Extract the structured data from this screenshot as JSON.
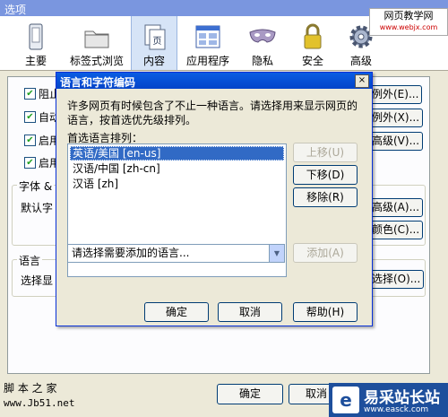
{
  "window": {
    "title": "选项"
  },
  "toolbar": {
    "items": [
      {
        "label": "主要",
        "icon": "general-icon"
      },
      {
        "label": "标签式浏览",
        "icon": "folder-icon"
      },
      {
        "label": "内容",
        "icon": "content-icon",
        "selected": true
      },
      {
        "label": "应用程序",
        "icon": "applications-icon"
      },
      {
        "label": "隐私",
        "icon": "privacy-mask-icon"
      },
      {
        "label": "安全",
        "icon": "lock-icon"
      },
      {
        "label": "高级",
        "icon": "gear-icon"
      }
    ]
  },
  "watermark_top": {
    "line1": "网页教学网",
    "line2": "www.webjx.com"
  },
  "content_pane": {
    "checkbox1": "阻止",
    "checkbox2": "自动",
    "checkbox3": "启用",
    "checkbox4": "启用",
    "exceptions1": "例外(E)...",
    "exceptions2": "例外(X)...",
    "advanced1": "高级(V)...",
    "fonts_group": "字体 & ",
    "default_font": "默认字",
    "advanced2": "高级(A)...",
    "colors": "颜色(C)...",
    "language_group": "语言",
    "language_text": "选择显",
    "choose": "选择(O)..."
  },
  "bottom_buttons": {
    "ok": "确定",
    "cancel": "取消"
  },
  "dialog": {
    "title": "语言和字符编码",
    "close": "×",
    "description": "许多网页有时候包含了不止一种语言。请选择用来显示网页的语言，按首选优先级排列。",
    "list_label": "首选语言排列：",
    "languages": [
      "英语/美国 [en-us]",
      "汉语/中国 [zh-cn]",
      "汉语 [zh]"
    ],
    "move_up": "上移(U)",
    "move_down": "下移(D)",
    "remove": "移除(R)",
    "select_placeholder": "请选择需要添加的语言...",
    "add": "添加(A)",
    "ok": "确定",
    "cancel": "取消",
    "help": "帮助(H)"
  },
  "watermark_bottom_left": {
    "line1": "脚 本 之 家",
    "line2": "www.Jb51.net"
  },
  "watermark_bottom_right": {
    "logo": "e",
    "line1": "易采站长站",
    "line2": "www.easck.com"
  },
  "colors": {
    "accent": "#0a5de3",
    "selection": "#316ac5",
    "window_bg": "#ece9d8"
  }
}
